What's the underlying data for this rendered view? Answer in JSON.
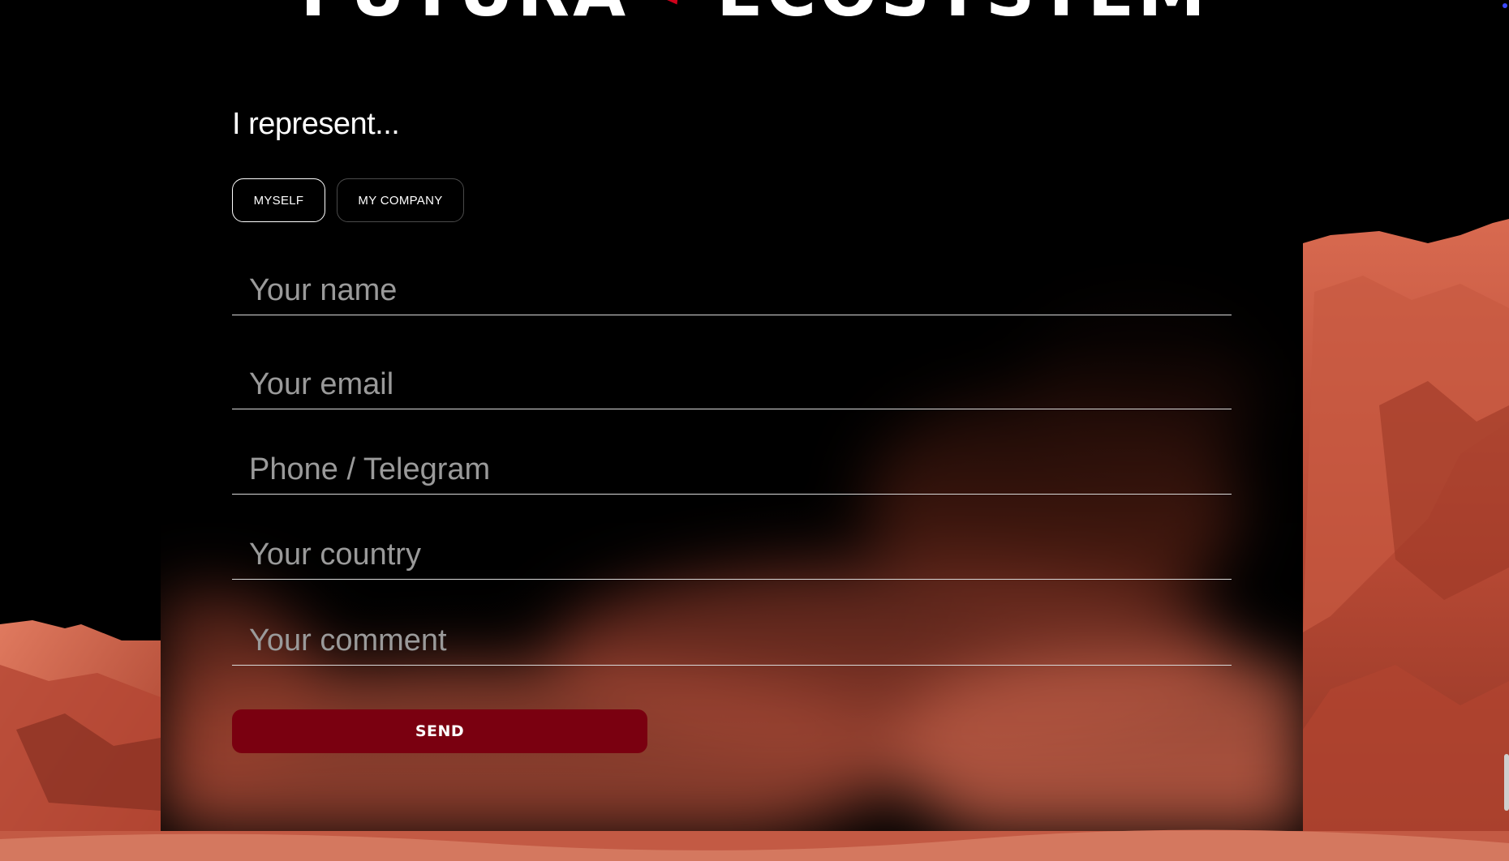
{
  "header": {
    "logo_left": "FUTURA",
    "logo_right": "ECOSYSTEM"
  },
  "form": {
    "question": "I represent...",
    "choices": [
      {
        "label": "MYSELF",
        "selected": true
      },
      {
        "label": "MY COMPANY",
        "selected": false
      }
    ],
    "fields": [
      {
        "placeholder": "Your name",
        "value": ""
      },
      {
        "placeholder": "Your email",
        "value": ""
      },
      {
        "placeholder": "Phone / Telegram",
        "value": ""
      },
      {
        "placeholder": "Your country",
        "value": ""
      },
      {
        "placeholder": "Your comment",
        "value": ""
      }
    ],
    "submit_label": "SEND"
  },
  "colors": {
    "background": "#000000",
    "accent": "#7a0010",
    "logo_mark": "#d0021b",
    "terrain": "#c9553e"
  }
}
